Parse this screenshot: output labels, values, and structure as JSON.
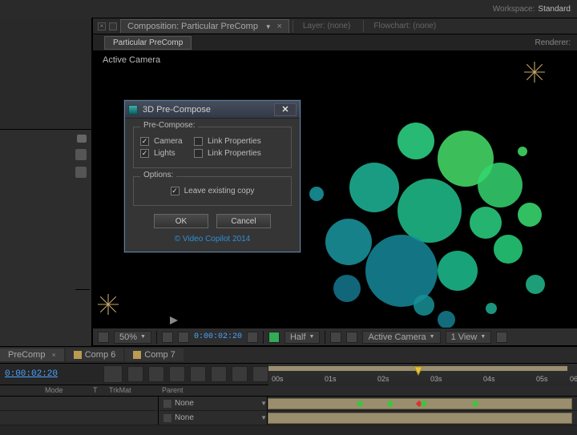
{
  "workspace": {
    "label": "Workspace:",
    "value": "Standard"
  },
  "comp_header": {
    "active_tab_prefix": "Composition:",
    "active_tab_name": "Particular PreComp",
    "layer_tab": "Layer: (none)",
    "flowchart_tab": "Flowchart: (none)"
  },
  "subtab": "Particular PreComp",
  "renderer_label": "Renderer:",
  "viewer_label": "Active Camera",
  "footer": {
    "zoom": "50%",
    "timecode": "0:00:02:20",
    "resolution": "Half",
    "view_mode": "Active Camera",
    "view_count": "1 View"
  },
  "dialog": {
    "title": "3D Pre-Compose",
    "section1": "Pre-Compose:",
    "camera": "Camera",
    "lights": "Lights",
    "link1": "Link Properties",
    "link2": "Link Properties",
    "section2": "Options:",
    "leave": "Leave existing copy",
    "ok": "OK",
    "cancel": "Cancel",
    "copyright": "© Video Copilot 2014"
  },
  "timeline": {
    "tabs": [
      "PreComp",
      "Comp 6",
      "Comp 7"
    ],
    "timecode": "0:00:02:20",
    "col_mode": "Mode",
    "col_t": "T",
    "col_trkmat": "TrkMat",
    "col_parent": "Parent",
    "parent_none": "None",
    "ruler_ticks": [
      "00s",
      "01s",
      "02s",
      "03s",
      "04s",
      "05s",
      "06"
    ]
  }
}
